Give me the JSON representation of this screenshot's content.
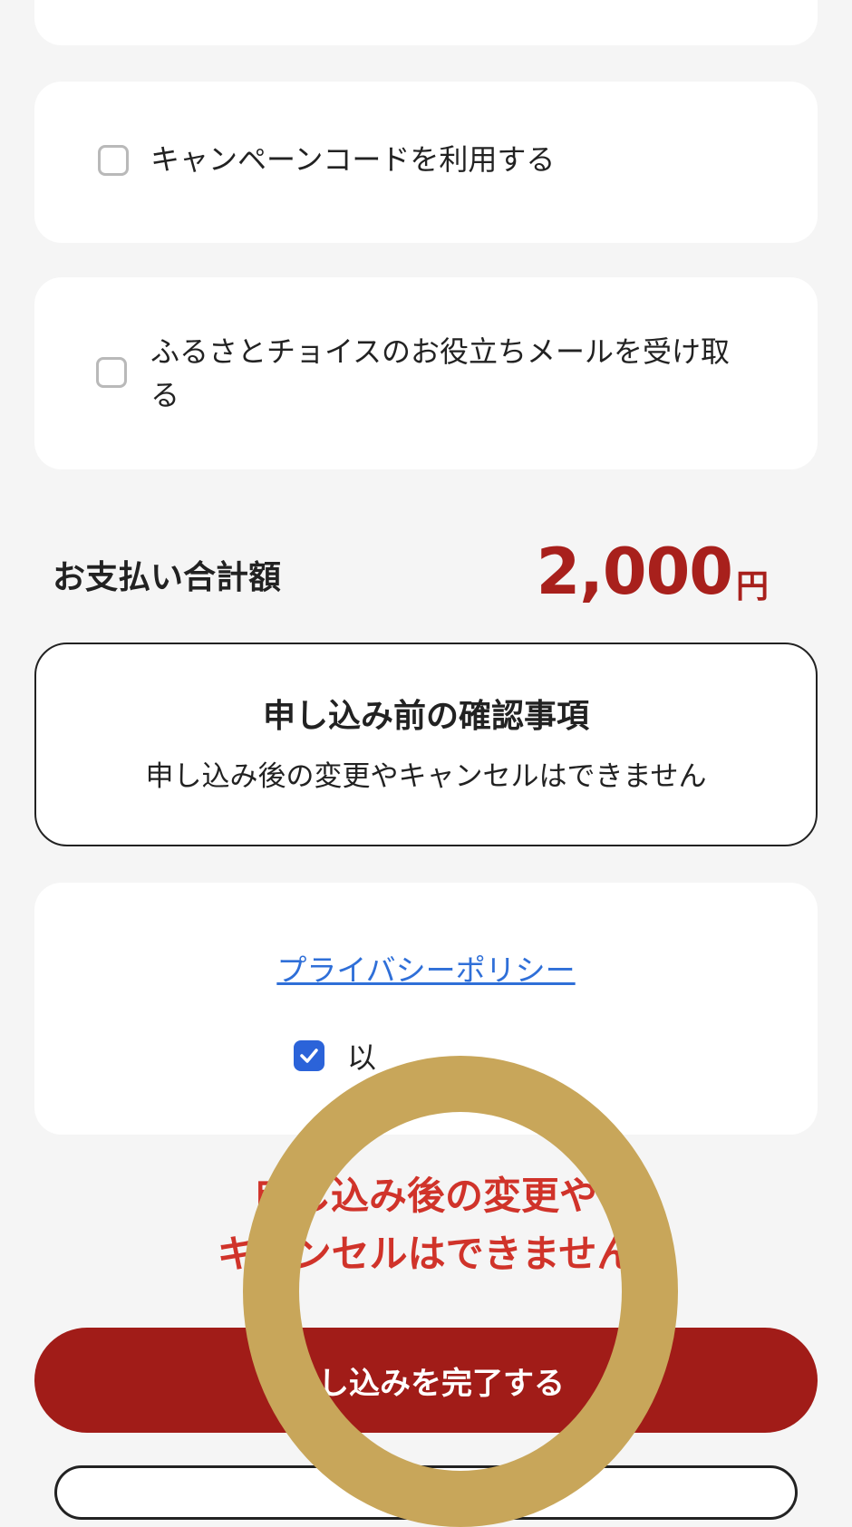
{
  "campaign": {
    "checkbox_label": "キャンペーンコードを利用する",
    "checked": false
  },
  "newsletter": {
    "checkbox_label_line1": "ふるさとチョイスのお役立ちメールを受け取",
    "checkbox_label_line2": "る",
    "checked": false
  },
  "total": {
    "label": "お支払い合計額",
    "amount": "2,000",
    "unit": "円"
  },
  "confirmation": {
    "title": "申し込み前の確認事項",
    "body": "申し込み後の変更やキャンセルはできません"
  },
  "privacy": {
    "link_label": "プライバシーポリシー",
    "agree_label_visible": "以",
    "checked": true
  },
  "warning": {
    "line1": "申し込み後の変更や",
    "line2": "キャンセルはできません"
  },
  "submit": {
    "label": "申し込みを完了する"
  },
  "colors": {
    "accent": "#a11c18",
    "price": "#a8201c",
    "warning": "#d0332a",
    "link": "#2f6fd8",
    "overlay_ring": "#c8a65a"
  }
}
